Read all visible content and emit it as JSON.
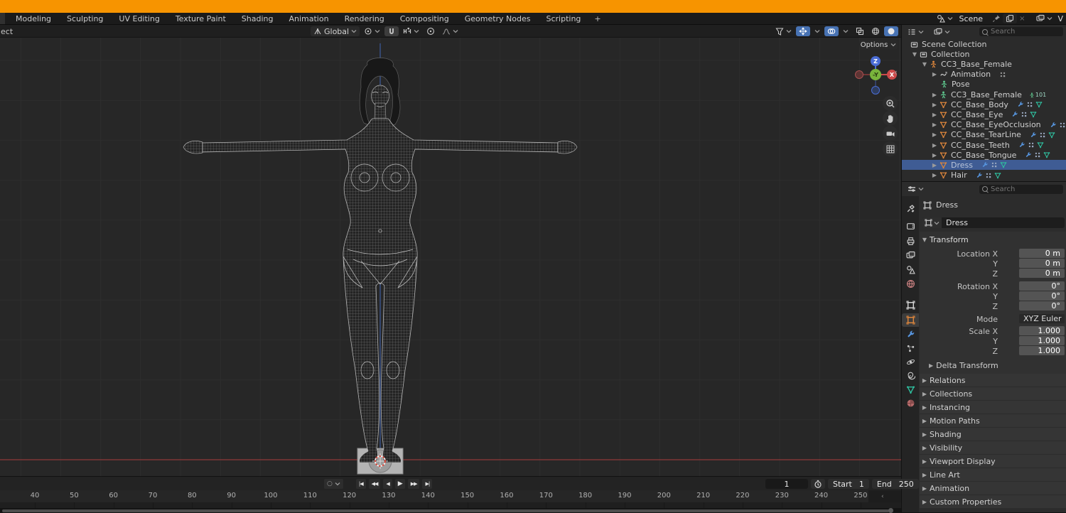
{
  "topbar": {
    "tabs": [
      "Modeling",
      "Sculpting",
      "UV Editing",
      "Texture Paint",
      "Shading",
      "Animation",
      "Rendering",
      "Compositing",
      "Geometry Nodes",
      "Scripting"
    ],
    "new_workspace": "+",
    "scene_label": "Scene",
    "close_x": "×",
    "view_layer_label": "V"
  },
  "viewport_header": {
    "mode_fragment": "ect",
    "orientation": "Global"
  },
  "viewport": {
    "options_label": "Options",
    "nav_axes": {
      "z": "Z",
      "x": "X",
      "neg_y": "-Y"
    }
  },
  "outliner": {
    "search_placeholder": "Search",
    "rows": [
      {
        "label": "Scene Collection",
        "depth": 0,
        "icon": "collection",
        "chev": ""
      },
      {
        "label": "Collection",
        "depth": 1,
        "icon": "collection",
        "chev": "open"
      },
      {
        "label": "CC3_Base_Female",
        "depth": 2,
        "icon": "armature-orange",
        "chev": "open"
      },
      {
        "label": "Animation",
        "depth": 3,
        "icon": "action",
        "chev": "closed",
        "trail": [
          "anim-dots"
        ]
      },
      {
        "label": "Pose",
        "depth": 3,
        "icon": "pose",
        "chev": ""
      },
      {
        "label": "CC3_Base_Female",
        "depth": 3,
        "icon": "armature-green",
        "chev": "closed",
        "badge": "101"
      },
      {
        "label": "CC_Base_Body",
        "depth": 3,
        "icon": "mesh",
        "chev": "closed",
        "trail": [
          "wrench",
          "modifier",
          "meshdata"
        ]
      },
      {
        "label": "CC_Base_Eye",
        "depth": 3,
        "icon": "mesh",
        "chev": "closed",
        "trail": [
          "wrench",
          "modifier",
          "meshdata"
        ]
      },
      {
        "label": "CC_Base_EyeOcclusion",
        "depth": 3,
        "icon": "mesh",
        "chev": "closed",
        "trail": [
          "wrench",
          "modifier",
          "meshdata"
        ]
      },
      {
        "label": "CC_Base_TearLine",
        "depth": 3,
        "icon": "mesh",
        "chev": "closed",
        "trail": [
          "wrench",
          "modifier",
          "meshdata"
        ]
      },
      {
        "label": "CC_Base_Teeth",
        "depth": 3,
        "icon": "mesh",
        "chev": "closed",
        "trail": [
          "wrench",
          "modifier",
          "meshdata"
        ]
      },
      {
        "label": "CC_Base_Tongue",
        "depth": 3,
        "icon": "mesh",
        "chev": "closed",
        "trail": [
          "wrench",
          "modifier",
          "meshdata"
        ]
      },
      {
        "label": "Dress",
        "depth": 3,
        "icon": "mesh",
        "chev": "closed",
        "trail": [
          "wrench",
          "modifier",
          "meshdata"
        ],
        "selected": true
      },
      {
        "label": "Hair",
        "depth": 3,
        "icon": "mesh",
        "chev": "closed",
        "trail": [
          "wrench",
          "modifier",
          "meshdata"
        ]
      }
    ]
  },
  "properties": {
    "search_placeholder": "Search",
    "tabs": [
      "tool",
      "render",
      "output",
      "view-layer",
      "scene",
      "world",
      "collection",
      "object",
      "modifiers",
      "particles",
      "physics",
      "constraints",
      "data",
      "material"
    ],
    "active_tab": "object",
    "breadcrumb_object": "Dress",
    "object_name": "Dress",
    "transform_title": "Transform",
    "transform_rows": [
      {
        "label": "Location X",
        "value": "0 m"
      },
      {
        "label": "Y",
        "value": "0 m"
      },
      {
        "label": "Z",
        "value": "0 m"
      },
      {
        "label": "Rotation X",
        "value": "0°"
      },
      {
        "label": "Y",
        "value": "0°"
      },
      {
        "label": "Z",
        "value": "0°"
      },
      {
        "label": "Mode",
        "value": "XYZ Euler",
        "kind": "dropdown"
      },
      {
        "label": "Scale X",
        "value": "1.000"
      },
      {
        "label": "Y",
        "value": "1.000"
      },
      {
        "label": "Z",
        "value": "1.000"
      }
    ],
    "subpanel_delta": "Delta Transform",
    "collapsed_panels": [
      "Relations",
      "Collections",
      "Instancing",
      "Motion Paths",
      "Shading",
      "Visibility",
      "Viewport Display",
      "Line Art",
      "Animation",
      "Custom Properties"
    ]
  },
  "timeline": {
    "icons": {
      "auto_key": "○",
      "jump_start": "|◀",
      "prev_key": "◀◀",
      "play_back": "◀",
      "play": "▶",
      "next_key": "▶▶",
      "jump_end": "▶|"
    },
    "current_frame": "1",
    "start_label": "Start",
    "start_value": "1",
    "end_label": "End",
    "end_value": "250",
    "ruler_frames": [
      40,
      50,
      60,
      70,
      80,
      90,
      100,
      110,
      120,
      130,
      140,
      150,
      160,
      170,
      180,
      190,
      200,
      210,
      220,
      230,
      240,
      250
    ]
  },
  "colors": {
    "accent_orange": "#f79400",
    "selection_blue": "#3f5c94",
    "widget_blue": "#4772b3"
  }
}
